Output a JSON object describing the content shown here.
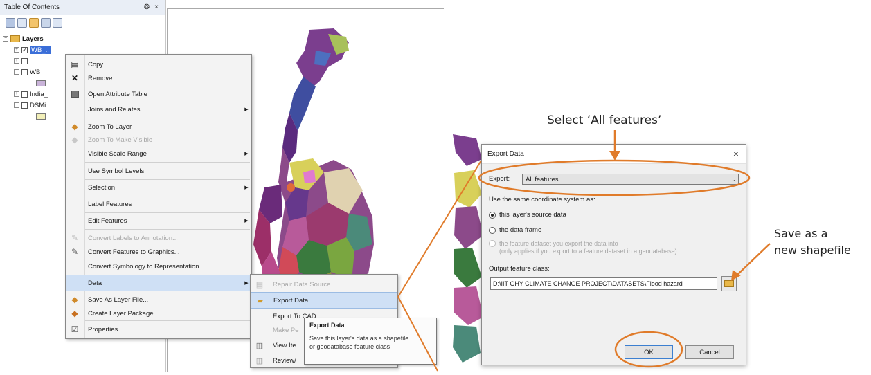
{
  "toc": {
    "title": "Table Of Contents",
    "pin": "❂",
    "close": "×",
    "root_label": "Layers",
    "layers": [
      {
        "label": "WB_..",
        "checked": true,
        "highlight": true
      },
      {
        "label": "",
        "checked": false
      },
      {
        "label": "WB",
        "checked": false
      },
      {
        "label": "India_",
        "checked": false
      },
      {
        "label": "DSMi",
        "checked": false
      }
    ]
  },
  "context_menu": {
    "items": [
      {
        "label": "Copy",
        "icon": "copy-icon"
      },
      {
        "label": "Remove",
        "icon": "remove-icon"
      },
      {
        "label": "Open Attribute Table",
        "icon": "table-icon"
      },
      {
        "label": "Joins and Relates",
        "submenu": true
      },
      {
        "label": "Zoom To Layer",
        "icon": "zoom-icon"
      },
      {
        "label": "Zoom To Make Visible",
        "disabled": true
      },
      {
        "label": "Visible Scale Range",
        "submenu": true
      },
      {
        "label": "Use Symbol Levels"
      },
      {
        "label": "Selection",
        "submenu": true
      },
      {
        "label": "Label Features"
      },
      {
        "label": "Edit Features",
        "submenu": true
      },
      {
        "label": "Convert Labels to Annotation...",
        "disabled": true
      },
      {
        "label": "Convert Features to Graphics..."
      },
      {
        "label": "Convert Symbology to Representation..."
      },
      {
        "label": "Data",
        "submenu": true,
        "highlight": true
      },
      {
        "label": "Save As Layer File..."
      },
      {
        "label": "Create Layer Package..."
      },
      {
        "label": "Properties..."
      }
    ]
  },
  "data_submenu": {
    "items": [
      {
        "label": "Repair Data Source...",
        "disabled": true
      },
      {
        "label": "Export Data...",
        "highlight": true
      },
      {
        "label": "Export To CAD..."
      },
      {
        "label": "Make Pe",
        "disabled": true
      },
      {
        "label": "View Ite"
      },
      {
        "label": "Review/"
      }
    ]
  },
  "tooltip": {
    "title": "Export Data",
    "line1": "Save this layer's data as a shapefile",
    "line2": "or geodatabase feature class"
  },
  "dialog": {
    "title": "Export Data",
    "close": "×",
    "export_label": "Export:",
    "export_value": "All features",
    "coord_label": "Use the same coordinate system as:",
    "opt1": "this layer's source data",
    "opt2": "the data frame",
    "opt3_line1": "the feature dataset you export the data into",
    "opt3_line2": "(only applies if you export to a feature dataset in a geodatabase)",
    "output_label": "Output feature class:",
    "output_value": "D:\\IIT GHY CLIMATE CHANGE PROJECT\\DATASETS\\Flood hazard",
    "ok": "OK",
    "cancel": "Cancel"
  },
  "annotations": {
    "select": "Select ‘All features’",
    "save_line1": "Save as a",
    "save_line2": "new shapefile",
    "color": "#e07b2a"
  }
}
